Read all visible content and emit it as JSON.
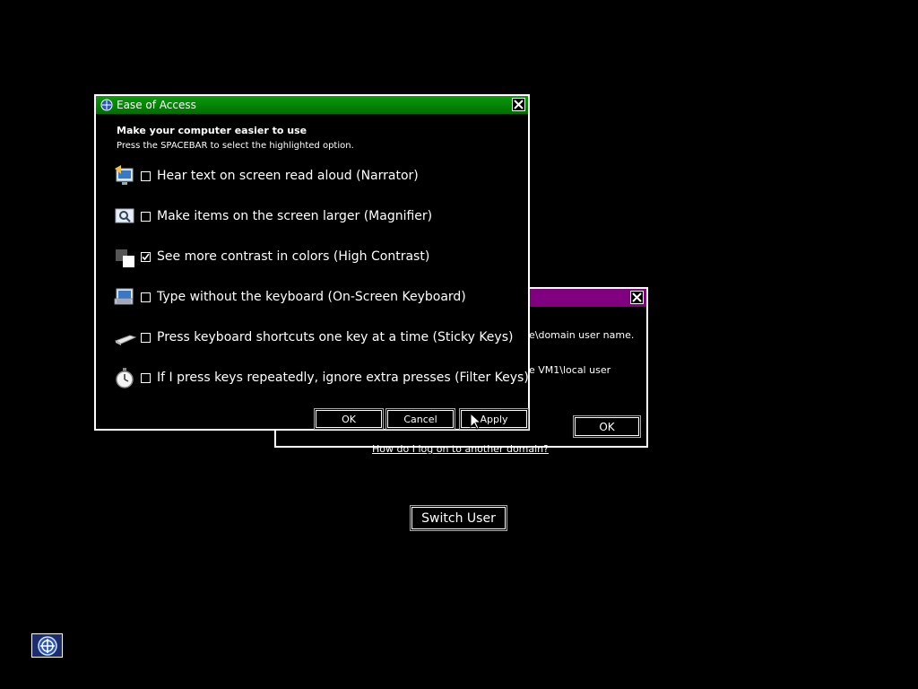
{
  "logon_dialog": {
    "hint1": "e\\domain user name.",
    "hint2": "e VM1\\local user",
    "ok_label": "OK",
    "title_color": "#800080"
  },
  "other_domain_link": "How do I log on to another domain?",
  "switch_user_label": "Switch User",
  "ease_icon": "ease-of-access-icon",
  "ease_dialog": {
    "title": "Ease of Access",
    "title_color": "#008000",
    "heading": "Make your computer easier to use",
    "subheading": "Press the SPACEBAR to select the highlighted option.",
    "options": [
      {
        "icon": "narrator-icon",
        "label": "Hear text on screen read aloud (Narrator)",
        "checked": false
      },
      {
        "icon": "magnifier-icon",
        "label": "Make items on the screen larger (Magnifier)",
        "checked": false
      },
      {
        "icon": "high-contrast-icon",
        "label": "See more contrast in colors (High Contrast)",
        "checked": true
      },
      {
        "icon": "keyboard-icon",
        "label": "Type without the keyboard (On-Screen Keyboard)",
        "checked": false
      },
      {
        "icon": "sticky-keys-icon",
        "label": "Press keyboard shortcuts one key at a time (Sticky Keys)",
        "checked": false
      },
      {
        "icon": "filter-keys-icon",
        "label": "If I press keys repeatedly, ignore extra presses (Filter Keys)",
        "checked": false
      }
    ],
    "ok_label": "OK",
    "cancel_label": "Cancel",
    "apply_label": "Apply"
  }
}
